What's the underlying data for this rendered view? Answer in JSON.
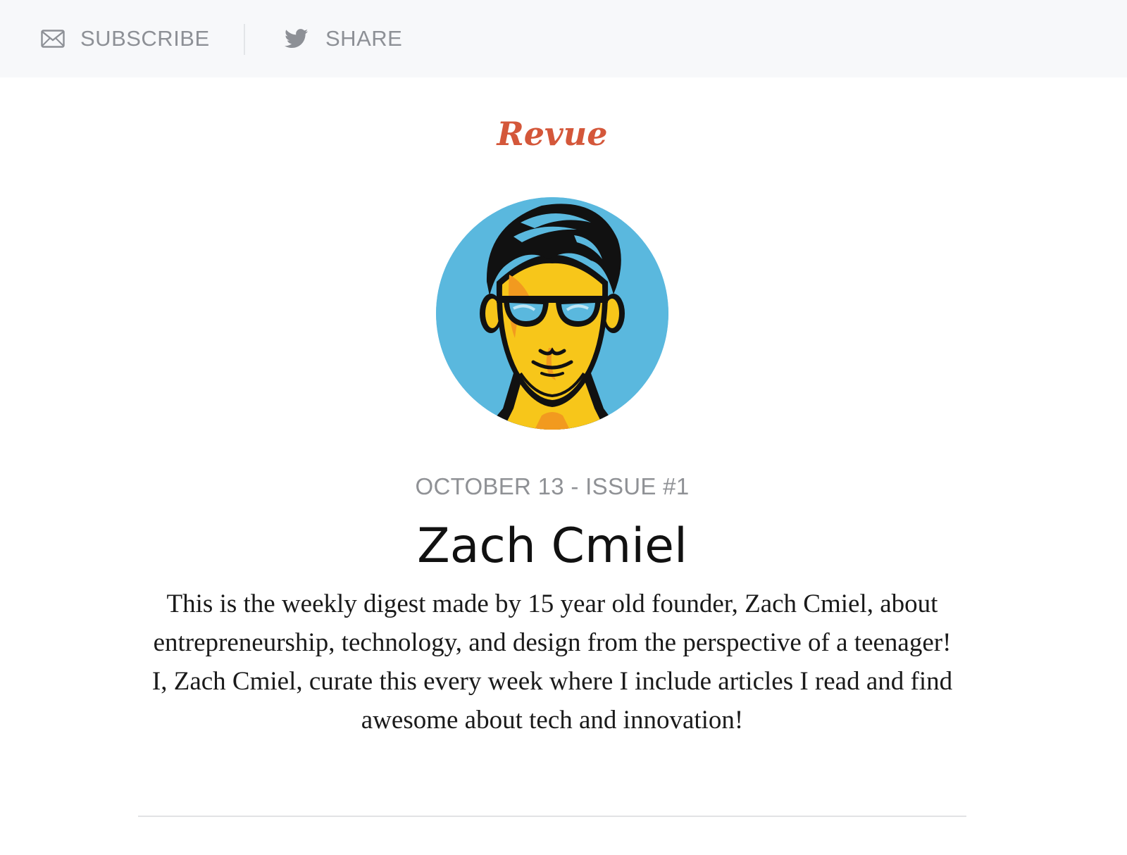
{
  "topbar": {
    "subscribe_label": "SUBSCRIBE",
    "share_label": "SHARE",
    "subscribe_icon": "envelope-icon",
    "share_icon": "twitter-bird-icon"
  },
  "brand": {
    "logo_text": "Revue",
    "logo_color": "#d4573a"
  },
  "issue": {
    "meta": "OCTOBER 13 - ISSUE #1",
    "author_name": "Zach Cmiel",
    "description": "This is the weekly digest made by 15 year old founder, Zach Cmiel, about entrepreneurship, technology, and design from the perspective of a teenager! I, Zach Cmiel, curate this every week where I include articles I read and find awesome about tech and innovation!"
  },
  "colors": {
    "topbar_bg": "#f7f8fa",
    "topbar_text": "#8d9096",
    "avatar_bg": "#5ab8de"
  }
}
